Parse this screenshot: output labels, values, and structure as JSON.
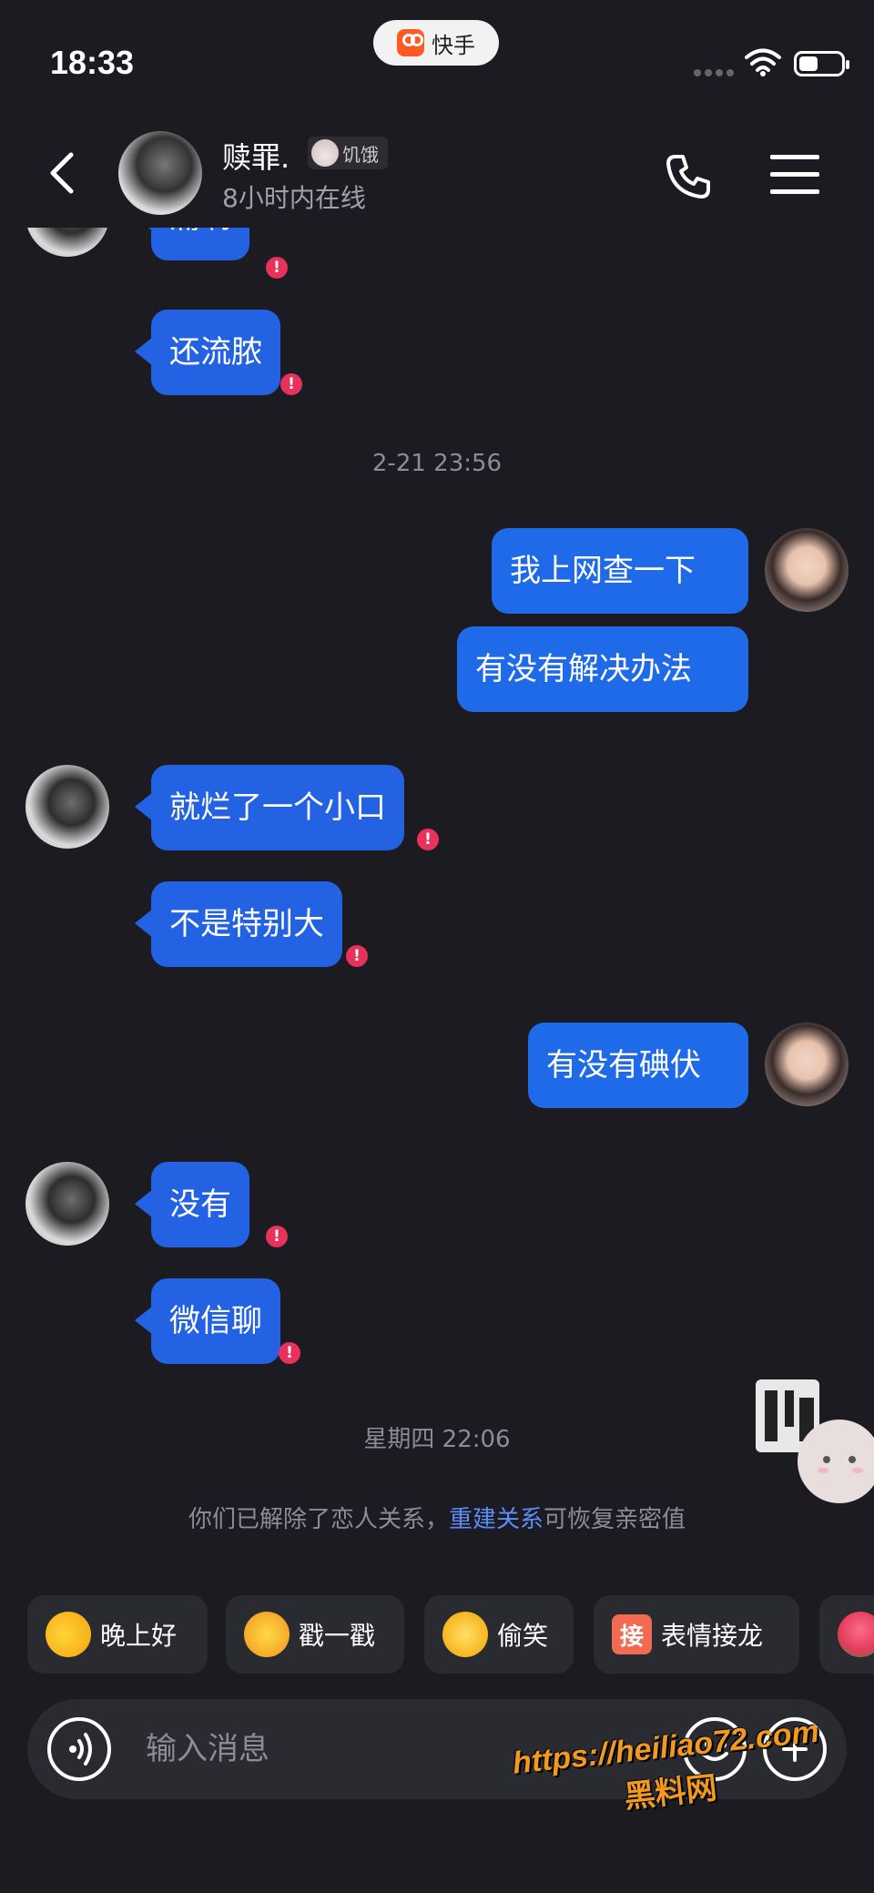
{
  "status_bar": {
    "time": "18:33",
    "app_name": "快手"
  },
  "header": {
    "contact_name": "赎罪.",
    "mood": "饥饿",
    "online_status": "8小时内在线"
  },
  "messages": [
    {
      "sender": "contact",
      "text": "痛啊",
      "failed": true
    },
    {
      "sender": "contact",
      "text": "还流脓",
      "failed": true
    },
    {
      "type": "timestamp",
      "text": "2-21 23:56"
    },
    {
      "sender": "me",
      "text": "我上网查一下"
    },
    {
      "sender": "me",
      "text": "有没有解决办法"
    },
    {
      "sender": "contact",
      "text": "就烂了一个小口",
      "failed": true
    },
    {
      "sender": "contact",
      "text": "不是特别大",
      "failed": true
    },
    {
      "sender": "me",
      "text": "有没有碘伏"
    },
    {
      "sender": "contact",
      "text": "没有",
      "failed": true
    },
    {
      "sender": "contact",
      "text": "微信聊",
      "failed": true
    },
    {
      "type": "timestamp",
      "text": "星期四 22:06"
    }
  ],
  "system_note": {
    "prefix": "你们已解除了恋人关系，",
    "link": "重建关系",
    "suffix": "可恢复亲密值"
  },
  "quick_replies": [
    {
      "label": "晚上好",
      "icon": "moon-emoji-icon"
    },
    {
      "label": "戳一戳",
      "icon": "poke-emoji-icon"
    },
    {
      "label": "偷笑",
      "icon": "snicker-emoji-icon"
    },
    {
      "label": "表情接龙",
      "icon": "jie-badge-icon",
      "badge": "接"
    },
    {
      "label": "",
      "icon": "flower-emoji-icon"
    }
  ],
  "input": {
    "placeholder": "输入消息"
  },
  "watermark": {
    "url": "https://heiliao72.com",
    "site": "黑料网"
  },
  "colors": {
    "background": "#1b1b21",
    "bubble": "#2363e3",
    "fail_badge": "#e8325c",
    "link": "#5b8ef5"
  }
}
